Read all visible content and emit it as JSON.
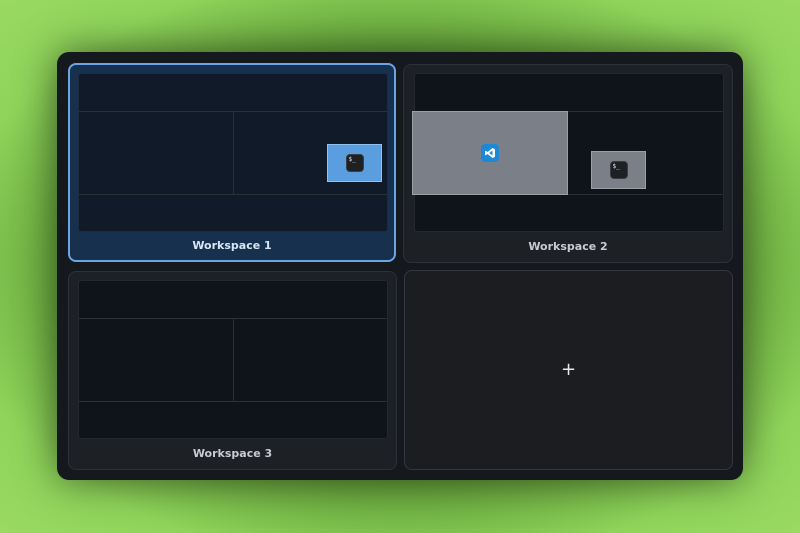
{
  "workspaces": [
    {
      "label": "Workspace 1",
      "active": true
    },
    {
      "label": "Workspace 2",
      "active": false
    },
    {
      "label": "Workspace 3",
      "active": false
    }
  ],
  "windows": {
    "ws1_terminal": {
      "icon": "terminal-icon",
      "glyph": "$_"
    },
    "ws2_vscode": {
      "icon": "vscode-icon"
    },
    "ws2_terminal": {
      "icon": "terminal-icon",
      "glyph": "$_"
    }
  },
  "add_workspace": {
    "glyph": "+",
    "icon": "plus-icon"
  },
  "colors": {
    "active_border": "#6aa6e6",
    "active_window": "#5b9ee0",
    "inactive_window": "#7b8088"
  }
}
